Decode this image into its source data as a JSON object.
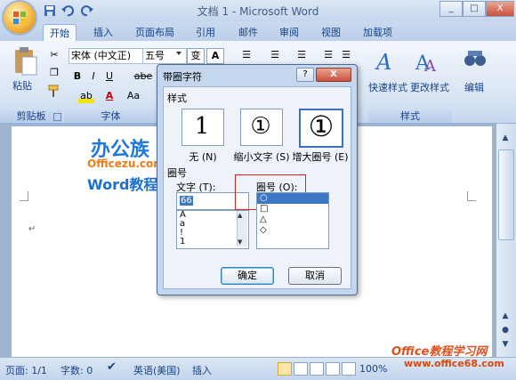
{
  "window": {
    "title": "文档 1 - Microsoft Word",
    "min_label": "_",
    "max_label": "□",
    "close_label": "X"
  },
  "tabs": [
    {
      "label": "开始"
    },
    {
      "label": "插入"
    },
    {
      "label": "页面布局"
    },
    {
      "label": "引用"
    },
    {
      "label": "邮件"
    },
    {
      "label": "审阅"
    },
    {
      "label": "视图"
    },
    {
      "label": "加载项"
    }
  ],
  "ribbon": {
    "paste_label": "粘贴",
    "clipboard_label": "剪贴板",
    "font_name": "宋体 (中文正)",
    "font_size": "五号",
    "wen_label": "变",
    "font_group_label": "字体",
    "bold": "B",
    "italic": "I",
    "underline": "U",
    "strike": "abe",
    "aa_label": "Aa",
    "a_label": "A",
    "quick_styles_label": "快速样式",
    "change_styles_label": "更改样式",
    "styles_group_label": "样式",
    "edit_label": "编辑"
  },
  "watermark": {
    "line1": "办公族",
    "line2": "Officezu.com",
    "line3": "Word教程",
    "site_cn": "Office教程学习网",
    "site_url": "www.office68.com"
  },
  "dialog": {
    "title": "带圈字符",
    "help": "?",
    "close": "X",
    "style_section": "样式",
    "styles": [
      {
        "glyph": "1",
        "label": "无 (N)"
      },
      {
        "glyph": "①",
        "label": "缩小文字 (S)"
      },
      {
        "glyph": "①",
        "label": "增大圈号 (E)"
      }
    ],
    "circle_section": "圈号",
    "text_label": "文字 (T):",
    "text_value": "66",
    "text_items": [
      "A",
      "a",
      "!",
      "1"
    ],
    "circle_label": "圈号 (O):",
    "circle_items": [
      "○",
      "□",
      "△",
      "◇"
    ],
    "ok": "确定",
    "cancel": "取消"
  },
  "status": {
    "page": "页面: 1/1",
    "words": "字数: 0",
    "lang": "英语(美国)",
    "mode": "插入",
    "zoom": "100%"
  }
}
